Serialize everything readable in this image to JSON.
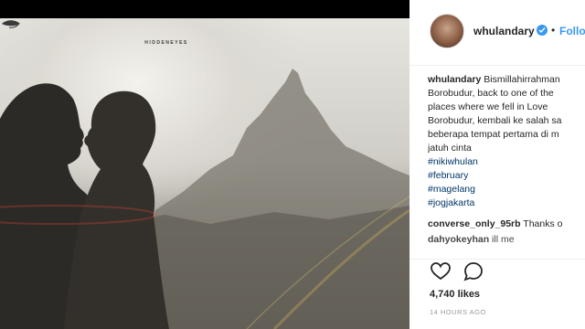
{
  "post": {
    "brand": "HIDDENEYES"
  },
  "header": {
    "username": "whulandary",
    "follow_label": "Follow",
    "separator": "•"
  },
  "caption": {
    "author": "whulandary",
    "lines": [
      "Bismillahirrahman",
      "Borobudur, back to one of the",
      "places where we fell in Love",
      "Borobudur, kembali ke salah sa",
      "beberapa tempat pertama di m",
      "jatuh cinta"
    ],
    "hashtags": [
      "#nikiwhulan",
      "#february",
      "#magelang",
      "#jogjakarta"
    ]
  },
  "comments": [
    {
      "author": "converse_only_95rb",
      "text": "Thanks o"
    },
    {
      "author": "dahyokeyhan",
      "text": "ill me"
    }
  ],
  "stats": {
    "likes": "4,740 likes",
    "timestamp": "14 HOURS AGO"
  },
  "icons": {
    "like": "heart-icon",
    "comment": "comment-bubble-icon",
    "verified": "verified-badge-icon"
  },
  "colors": {
    "link": "#3897f0",
    "hashtag": "#003569",
    "text": "#262626",
    "muted": "#999999"
  }
}
